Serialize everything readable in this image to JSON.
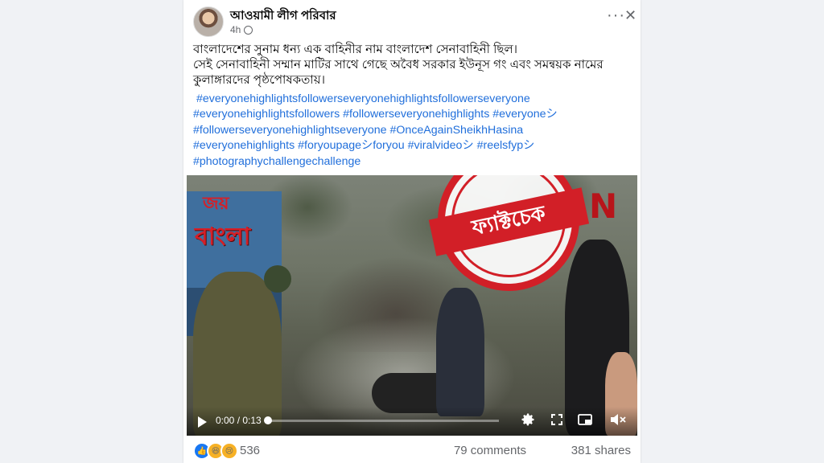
{
  "post": {
    "author": "আওয়ামী লীগ পরিবার",
    "time": "4h",
    "more_icon": "more-horizontal-icon",
    "close_icon": "close-icon",
    "text_lines": [
      "বাংলাদেশের সুনাম ধন্য এক বাহিনীর নাম বাংলাদেশ সেনাবাহিনী ছিল।",
      "সেই সেনাবাহিনী সম্মান মাটির সাথে গেছে  অবৈধ সরকার ইউনূস গং  এবং সমন্বয়ক নামের",
      "কুলাঙ্গারদের পৃষ্ঠপোষকতায়।"
    ],
    "hashtags": [
      "#everyonehighlightsfollowerseveryonehighlightsfollowerseveryone",
      "#everyonehighlightsfollowers",
      "#followerseveryonehighlights",
      "#everyoneシ",
      "#followerseveryonehighlightseveryone",
      "#OnceAgainSheikhHasina",
      "#everyonehighlights",
      "#foryoupageシforyou",
      "#viralvideoシ",
      "#reelsfypシ",
      "#photographychallengechallenge"
    ]
  },
  "video": {
    "overlay_logo_top": "জয়",
    "overlay_logo_bottom": "বাংলা",
    "channel_mark": "N",
    "stamp_text": "ফ্যাক্টচেক",
    "current_time": "0:00",
    "duration": "0:13",
    "time_readout": "0:00 / 0:13",
    "progress_fraction": 0.0,
    "icons": [
      "play-icon",
      "settings-gear-icon",
      "expand-icon",
      "picture-in-picture-icon",
      "volume-muted-icon"
    ]
  },
  "footer": {
    "reaction_count": "536",
    "comments": "79 comments",
    "shares": "381 shares"
  },
  "colors": {
    "link_blue": "#216fdb",
    "stamp_red": "#d21f27",
    "muted_text": "#65676b"
  }
}
